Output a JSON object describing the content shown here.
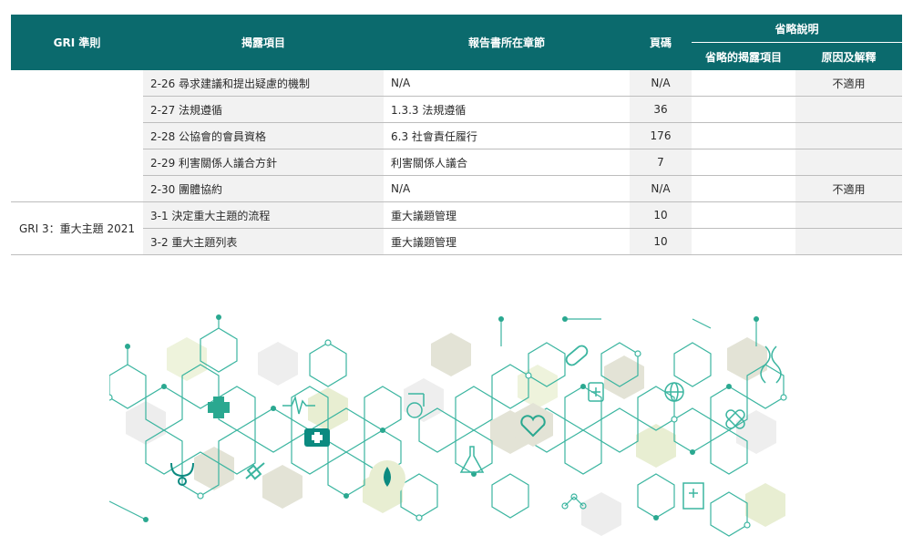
{
  "table": {
    "headers": {
      "standard": "GRI 準則",
      "disclosure": "揭露項目",
      "chapter": "報告書所在章節",
      "page": "頁碼",
      "omission": "省略說明",
      "omitted_item": "省略的揭露項目",
      "reason": "原因及解釋"
    },
    "group_gri2": {
      "standard": ""
    },
    "group_gri3": {
      "standard": "GRI 3：重大主題 2021"
    },
    "rows": [
      {
        "disclosure": "2-26 尋求建議和提出疑慮的機制",
        "chapter": "N/A",
        "page": "N/A",
        "omitted_item": "",
        "reason": "不適用"
      },
      {
        "disclosure": "2-27 法規遵循",
        "chapter": "1.3.3 法規遵循",
        "page": "36",
        "omitted_item": "",
        "reason": ""
      },
      {
        "disclosure": "2-28 公協會的會員資格",
        "chapter": "6.3 社會責任履行",
        "page": "176",
        "omitted_item": "",
        "reason": ""
      },
      {
        "disclosure": "2-29 利害關係人議合方針",
        "chapter": "利害關係人議合",
        "page": "7",
        "omitted_item": "",
        "reason": ""
      },
      {
        "disclosure": "2-30 團體協約",
        "chapter": "N/A",
        "page": "N/A",
        "omitted_item": "",
        "reason": "不適用"
      },
      {
        "disclosure": "3-1 決定重大主題的流程",
        "chapter": "重大議題管理",
        "page": "10",
        "omitted_item": "",
        "reason": ""
      },
      {
        "disclosure": "3-2 重大主題列表",
        "chapter": "重大議題管理",
        "page": "10",
        "omitted_item": "",
        "reason": ""
      }
    ]
  },
  "decoration": {
    "accent_color": "#0b6a6d",
    "line_color": "#3bb5a0",
    "icons": [
      "medical-cross-icon",
      "heartbeat-line-icon",
      "first-aid-kit-icon",
      "stethoscope-icon",
      "syringe-icon",
      "blood-drop-icon",
      "wheelchair-icon",
      "flask-icon",
      "heart-pulse-icon",
      "pill-icon",
      "medicine-bottle-icon",
      "globe-icon",
      "bandage-icon",
      "dna-icon",
      "medical-report-icon",
      "molecule-icon"
    ]
  }
}
